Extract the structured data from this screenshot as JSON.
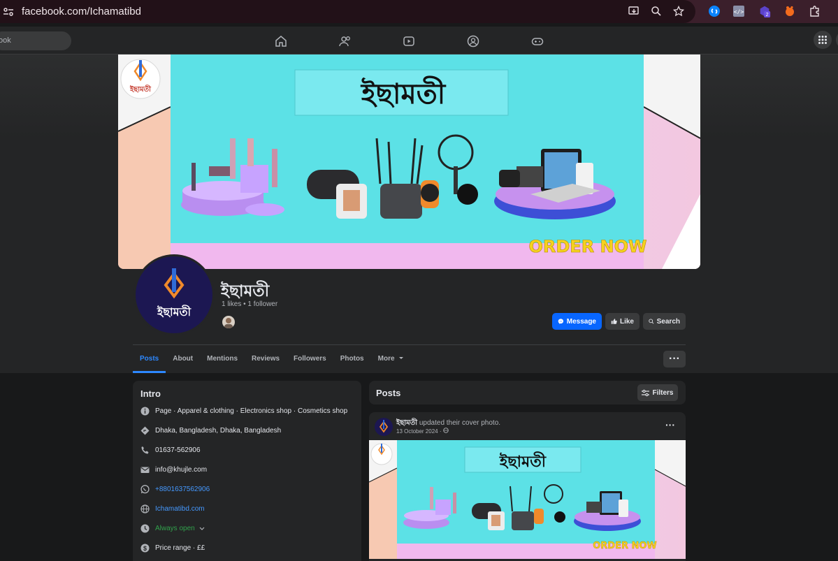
{
  "browser": {
    "url": "facebook.com/Ichamatibd",
    "extension_badge": "2"
  },
  "fb_nav": {
    "search_placeholder": "ook"
  },
  "cover": {
    "title": "ইছামতী",
    "order_text": "ORDER NOW",
    "logo_text": "ইছামতী"
  },
  "page": {
    "name": "ইছামতী",
    "stats": "1 likes • 1 follower",
    "logo_text": "ইছামতী"
  },
  "actions": {
    "message": "Message",
    "like": "Like",
    "search": "Search",
    "more_dots": "···"
  },
  "tabs": [
    "Posts",
    "About",
    "Mentions",
    "Reviews",
    "Followers",
    "Photos",
    "More"
  ],
  "intro": {
    "title": "Intro",
    "category": "Page · Apparel & clothing · Electronics shop · Cosmetics shop",
    "address": "Dhaka, Bangladesh, Dhaka, Bangladesh",
    "phone": "01637-562906",
    "email": "info@khujle.com",
    "whatsapp": "+8801637562906",
    "website": "Ichamatibd.com",
    "hours": "Always open",
    "price": "Price range · ££"
  },
  "posts": {
    "title": "Posts",
    "filters": "Filters",
    "post": {
      "author": "ইছামতী",
      "action": " updated their cover photo.",
      "date": "13 October 2024 · ",
      "menu": "···"
    }
  },
  "colors": {
    "accent": "#0866ff",
    "cover_cyan": "#5ce1e6",
    "order_yellow": "#f5d21f"
  }
}
